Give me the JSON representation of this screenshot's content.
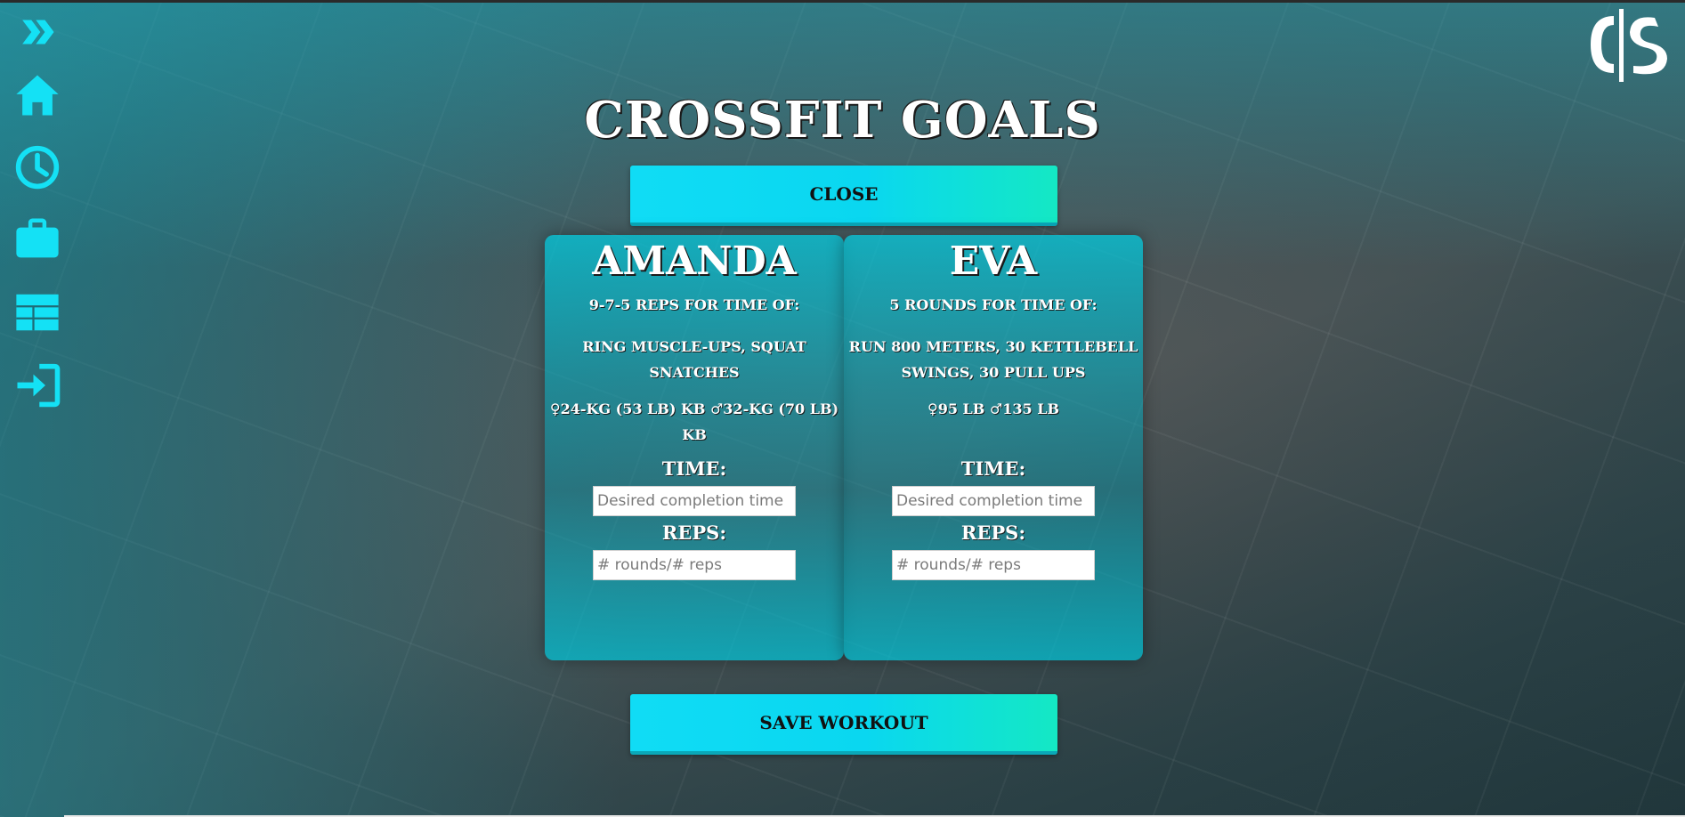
{
  "page": {
    "title": "CrossFit Goals"
  },
  "sidebar": {
    "items": [
      {
        "icon": "double-chevron-right-icon"
      },
      {
        "icon": "home-icon"
      },
      {
        "icon": "clock-icon"
      },
      {
        "icon": "briefcase-icon"
      },
      {
        "icon": "table-icon"
      },
      {
        "icon": "sign-in-icon"
      }
    ]
  },
  "logo": {
    "text": "C|S"
  },
  "buttons": {
    "close_label": "Close",
    "save_label": "Save Workout"
  },
  "workouts": [
    {
      "name": "Amanda",
      "scheme": "9-7-5 reps for time of:",
      "movements": "Ring Muscle-ups, Squat Snatches",
      "weights": "♀24-kg (53 lb) KB ♂32-kg (70 lb) KB",
      "time_label": "Time:",
      "time_placeholder": "Desired completion time",
      "reps_label": "Reps:",
      "reps_placeholder": "# rounds/# reps"
    },
    {
      "name": "Eva",
      "scheme": "5 rounds for time of:",
      "movements": "Run 800 meters, 30 kettlebell swings, 30 Pull Ups",
      "weights": "♀95 lb ♂135 lb",
      "time_label": "Time:",
      "time_placeholder": "Desired completion time",
      "reps_label": "Reps:",
      "reps_placeholder": "# rounds/# reps"
    }
  ],
  "colors": {
    "accent": "#00e5ff",
    "button_gradient_end": "#14e8c4",
    "card_teal": "#00c8dc",
    "text": "#ffffff"
  }
}
